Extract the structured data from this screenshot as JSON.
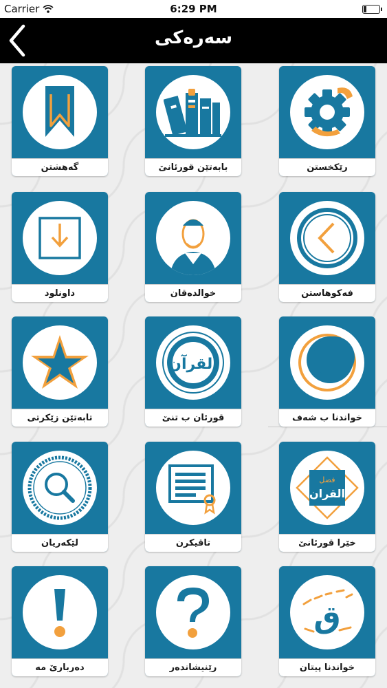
{
  "status_bar": {
    "carrier": "Carrier",
    "time": "6:29 PM"
  },
  "header": {
    "title": "سەرەکی"
  },
  "menu": {
    "items": [
      {
        "label": "گەهشتن",
        "icon": "bookmark-icon"
      },
      {
        "label": "بابەتێن قورئانێ",
        "icon": "books-icon"
      },
      {
        "label": "رێکخستن",
        "icon": "settings-icon"
      },
      {
        "label": "داونلود",
        "icon": "download-icon"
      },
      {
        "label": "خوالدەقان",
        "icon": "reciter-icon"
      },
      {
        "label": "فەکوهاستن",
        "icon": "share-icon"
      },
      {
        "label": "تابەتێن زێکرتی",
        "icon": "star-icon"
      },
      {
        "label": "قورئان ب تنێ",
        "icon": "quran-calligraphy-icon"
      },
      {
        "label": "خواندنا ب شەف",
        "icon": "night-moon-icon"
      },
      {
        "label": "لێکەریان",
        "icon": "search-icon"
      },
      {
        "label": "تاقیکرن",
        "icon": "quiz-icon"
      },
      {
        "label": "خێرا قورئانێ",
        "icon": "quran-virtue-icon"
      },
      {
        "label": "دەربارێ مە",
        "icon": "about-icon"
      },
      {
        "label": "رێنیشاندەر",
        "icon": "help-icon"
      },
      {
        "label": "خواندنا پیتان",
        "icon": "letters-icon"
      }
    ],
    "quran_text": "القرآن",
    "virtue_small": "فضل",
    "virtue_big": "القران",
    "letter_glyph": "ق",
    "colors": {
      "tile": "#1878a0",
      "accent": "#f2a03d",
      "text": "#1a1a1a"
    }
  }
}
